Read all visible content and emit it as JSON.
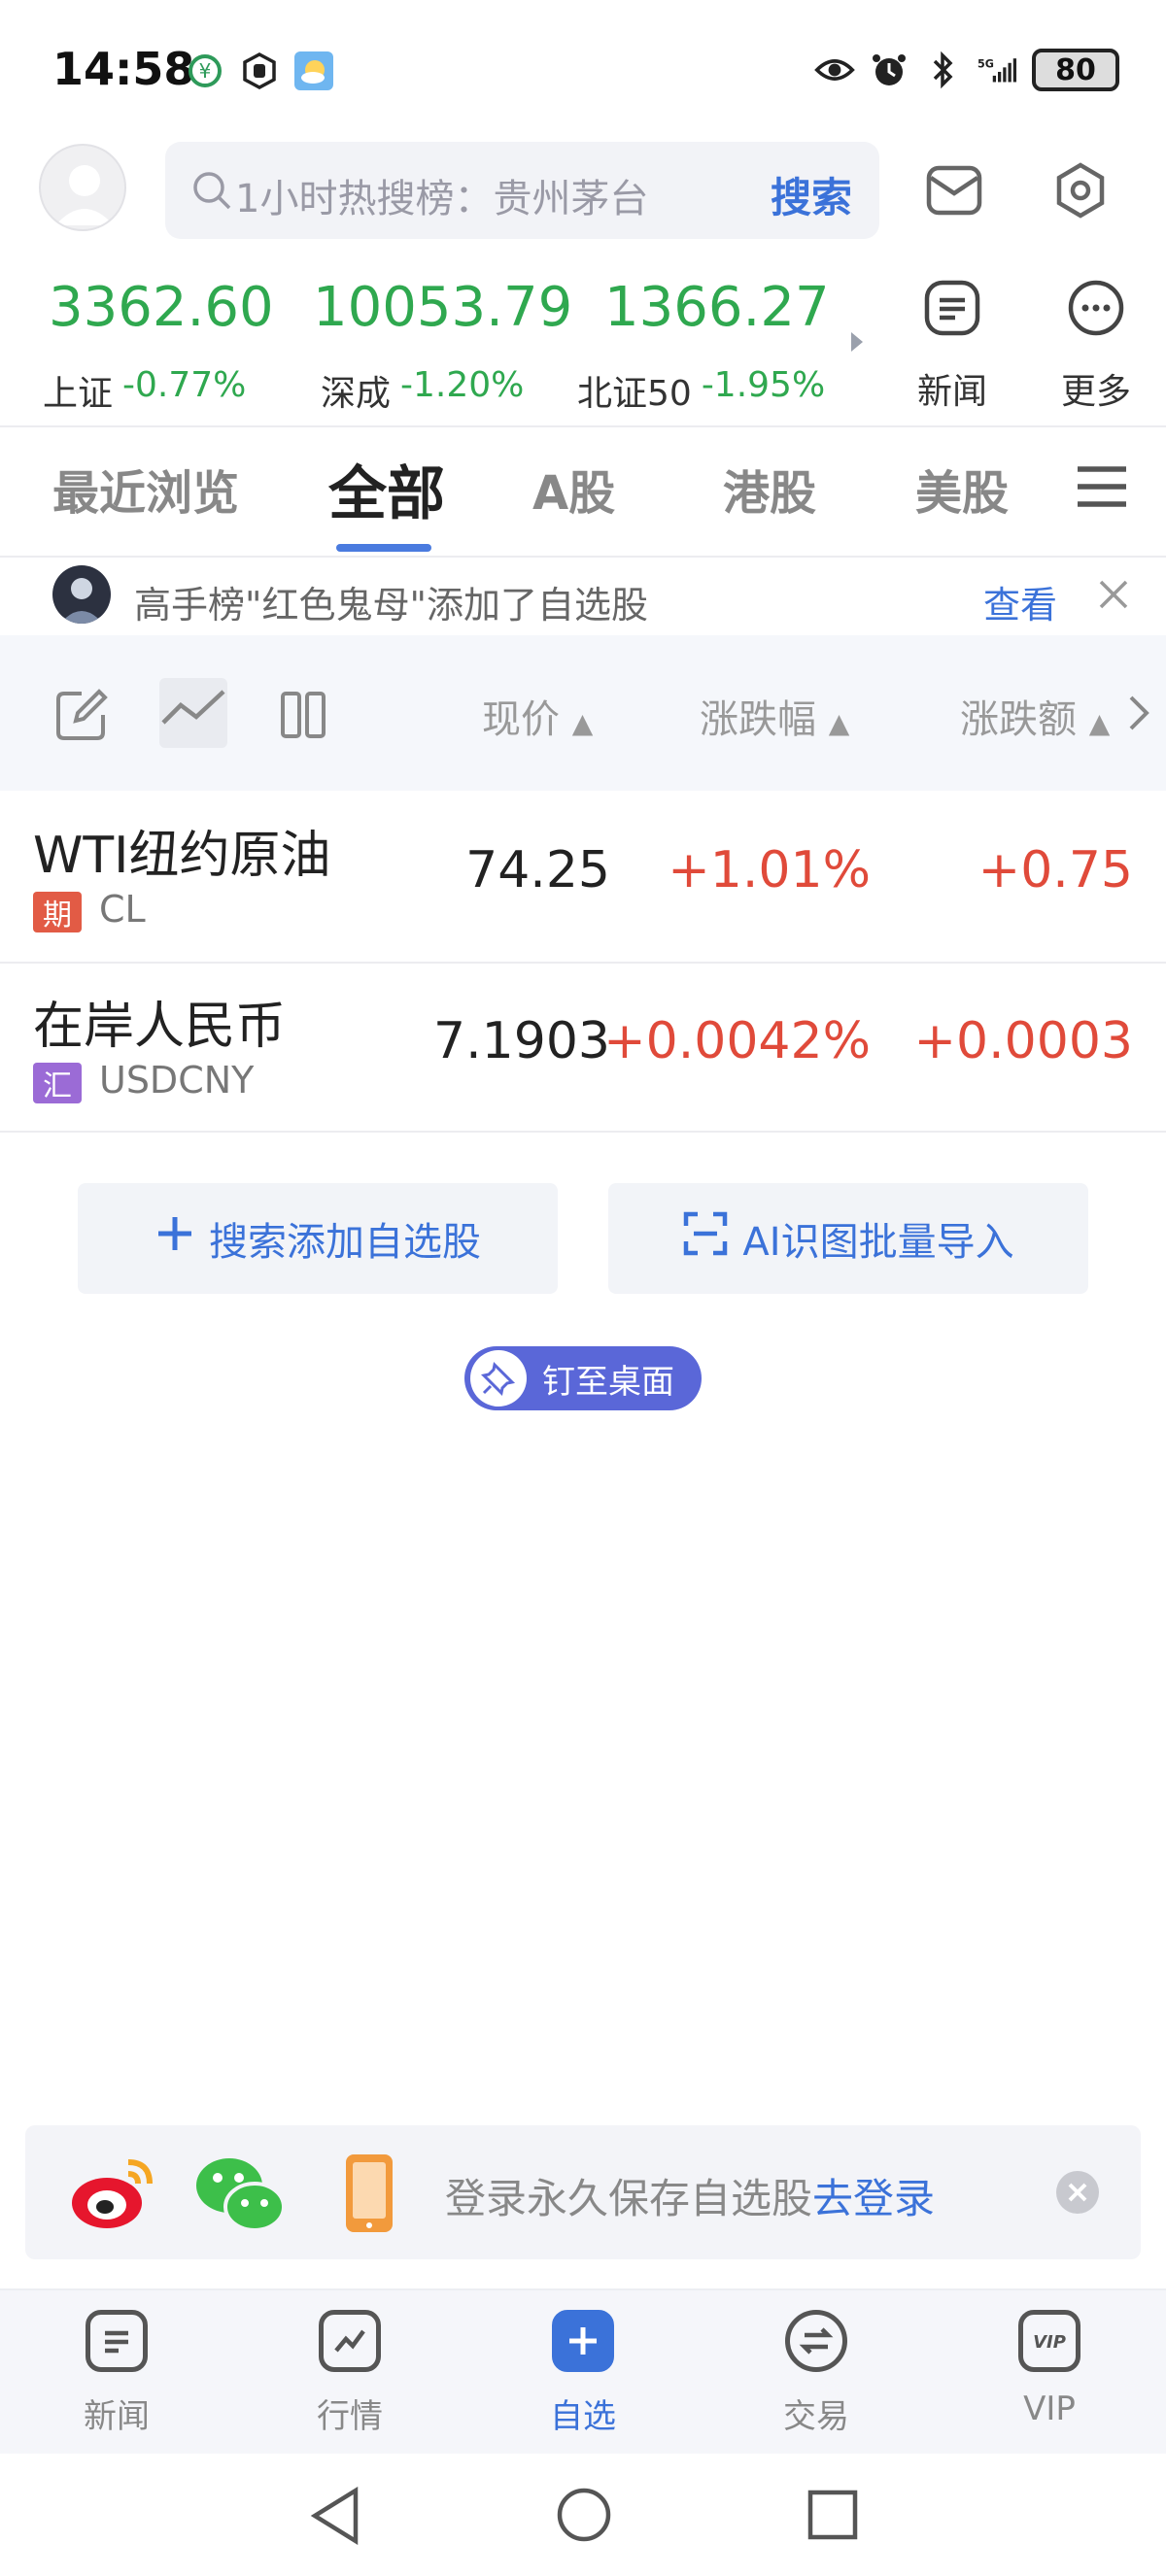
{
  "status_bar": {
    "time": "14:58",
    "battery": "80",
    "icons_left": [
      "wallet-icon",
      "hand-icon",
      "weather-icon"
    ],
    "icons_right": [
      "eye-icon",
      "alarm-icon",
      "bluetooth-icon",
      "signal-5g-icon",
      "battery-icon"
    ]
  },
  "header": {
    "search_placeholder": "1小时热搜榜：贵州茅台",
    "search_button": "搜索"
  },
  "indices": [
    {
      "value": "3362.60",
      "label": "上证",
      "change": "-0.77%"
    },
    {
      "value": "10053.79",
      "label": "深成",
      "change": "-1.20%"
    },
    {
      "value": "1366.27",
      "label": "北证50",
      "change": "-1.95%"
    }
  ],
  "quick_links": {
    "news": "新闻",
    "more": "更多"
  },
  "tabs": [
    {
      "label": "最近浏览",
      "active": false
    },
    {
      "label": "全部",
      "active": true
    },
    {
      "label": "A股",
      "active": false
    },
    {
      "label": "港股",
      "active": false
    },
    {
      "label": "美股",
      "active": false
    }
  ],
  "notice": {
    "text": "高手榜\"红色鬼母\"添加了自选股",
    "action": "查看"
  },
  "columns": {
    "price": "现价",
    "change_pct": "涨跌幅",
    "change_amt": "涨跌额"
  },
  "rows": [
    {
      "name": "WTI纽约原油",
      "tag": "期",
      "tag_color": "#e25b45",
      "code": "CL",
      "price": "74.25",
      "change_pct": "+1.01%",
      "change_amt": "+0.75"
    },
    {
      "name": "在岸人民币",
      "tag": "汇",
      "tag_color": "#9b6bd6",
      "code": "USDCNY",
      "price": "7.1903",
      "change_pct": "+0.0042%",
      "change_amt": "+0.0003"
    }
  ],
  "actions": {
    "search_add": "搜索添加自选股",
    "ai_import": "AI识图批量导入",
    "pin": "钉至桌面"
  },
  "login_banner": {
    "text": "登录永久保存自选股",
    "link": "去登录"
  },
  "bottom_nav": [
    {
      "label": "新闻",
      "icon": "news-icon",
      "active": false
    },
    {
      "label": "行情",
      "icon": "chart-icon",
      "active": false
    },
    {
      "label": "自选",
      "icon": "plus-icon",
      "active": true
    },
    {
      "label": "交易",
      "icon": "exchange-icon",
      "active": false
    },
    {
      "label": "VIP",
      "icon": "vip-icon",
      "active": false
    }
  ],
  "colors": {
    "accent": "#3b72d9",
    "down": "#2fa84f",
    "up": "#e04a3a"
  }
}
